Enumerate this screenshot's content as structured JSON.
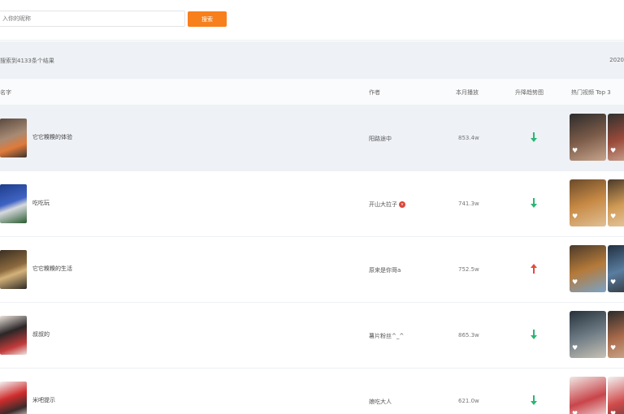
{
  "search": {
    "placeholder": "入你的昵称",
    "button_label": "搜索"
  },
  "summary": {
    "text": "搜索到4133条个结果",
    "date": "2020"
  },
  "columns": {
    "name": "名字",
    "author": "作者",
    "plays": "本月播放",
    "trend": "升降趋势图",
    "top": "热门视频 Top 3"
  },
  "colors": {
    "accent": "#f77f1c",
    "up": "#e04d3c",
    "down": "#2bb673"
  },
  "rows": [
    {
      "title": "它它糗糗的体验",
      "author": "阳路途中",
      "plays": "853.4w",
      "trend": "down",
      "active": true,
      "verified": false
    },
    {
      "title": "吃吃玩",
      "author": "开山大拉子",
      "plays": "741.3w",
      "trend": "down",
      "active": false,
      "verified": true
    },
    {
      "title": "它它糗糗的生活",
      "author": "原来是你哥a",
      "plays": "752.5w",
      "trend": "up",
      "active": false,
      "verified": false
    },
    {
      "title": "叔叔的",
      "author": "薯片粉丝^_^",
      "plays": "865.3w",
      "trend": "down",
      "active": false,
      "verified": false
    },
    {
      "title": "米吧提示",
      "author": "娘吃大人",
      "plays": "621.0w",
      "trend": "down",
      "active": false,
      "verified": false
    }
  ]
}
